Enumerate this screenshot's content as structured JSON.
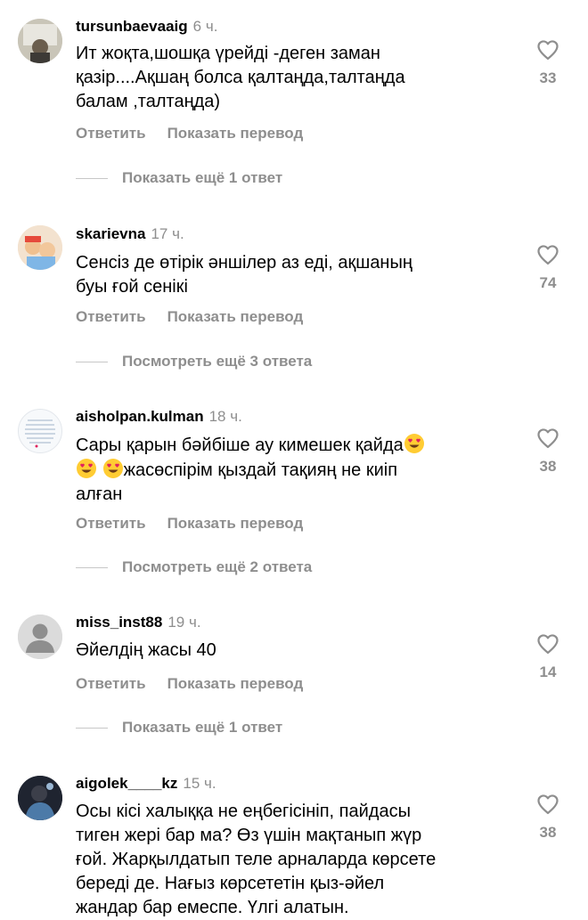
{
  "comments": [
    {
      "username": "tursunbaevaaig",
      "time": "6 ч.",
      "lines": [
        "Ит жоқта,шошқа үрейді -деген заман",
        "қазір....Ақшаң болса қалтаңда,талтаңда",
        "балам ,талтаңда)"
      ],
      "likes": "33",
      "more": "Показать ещё 1 ответ"
    },
    {
      "username": "skarievna",
      "time": "17 ч.",
      "lines": [
        "Сенсіз де өтірік әншілер аз еді, ақшаның",
        "буы ғой сенікі"
      ],
      "likes": "74",
      "more": "Посмотреть ещё 3 ответа"
    },
    {
      "username": "aisholpan.kulman",
      "time": "18 ч.",
      "lines": [
        "Сары қарын бәйбіше ау кимешек қайда",
        "жасөспірім қыздай тақияң не киіп",
        "алған"
      ],
      "likes": "38",
      "more": "Посмотреть ещё 2 ответа"
    },
    {
      "username": "miss_inst88",
      "time": "19 ч.",
      "lines": [
        "Әйелдің жасы 40"
      ],
      "likes": "14",
      "more": "Показать ещё 1 ответ"
    },
    {
      "username": "aigolek____kz",
      "time": "15 ч.",
      "lines": [
        "Осы кісі халыққа не еңбегісініп, пайдасы",
        "тиген жері бар ма? Өз үшін мақтанып жүр",
        "ғой. Жарқылдатып теле арналарда көрсете",
        "береді де. Нағыз көрсететін қыз-әйел",
        "жандар бар емеспе. Үлгі алатын."
      ],
      "likes": "38"
    }
  ],
  "actions": {
    "reply": "Ответить",
    "translate": "Показать перевод"
  },
  "icons": {
    "like": "heart-outline-icon",
    "emoji": "heart-eyes-emoji"
  }
}
